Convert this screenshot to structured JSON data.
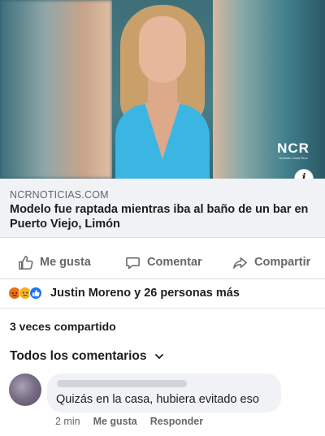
{
  "media": {
    "logo_text": "NCR",
    "logo_subtext": "Noticias Costa Rica",
    "info_icon": "info-icon"
  },
  "link_preview": {
    "domain": "NCRNOTICIAS.COM",
    "title": "Modelo fue raptada mientras iba al baño de un bar en Puerto Viejo, Limón"
  },
  "actions": {
    "like_label": "Me gusta",
    "comment_label": "Comentar",
    "share_label": "Compartir"
  },
  "reactions": {
    "icons": [
      "angry-reaction-icon",
      "sad-reaction-icon",
      "like-reaction-icon"
    ],
    "summary": "Justin Moreno y 26 personas más"
  },
  "shares": {
    "text": "3 veces compartido"
  },
  "comments": {
    "header": "Todos los comentarios",
    "items": [
      {
        "text": "Quizás en la casa, hubiera evitado eso",
        "time": "2 min",
        "like_label": "Me gusta",
        "reply_label": "Responder"
      }
    ]
  },
  "colors": {
    "accent_blue": "#1877f2",
    "text_secondary": "#65676b",
    "preview_bg": "#f0f2f5"
  }
}
